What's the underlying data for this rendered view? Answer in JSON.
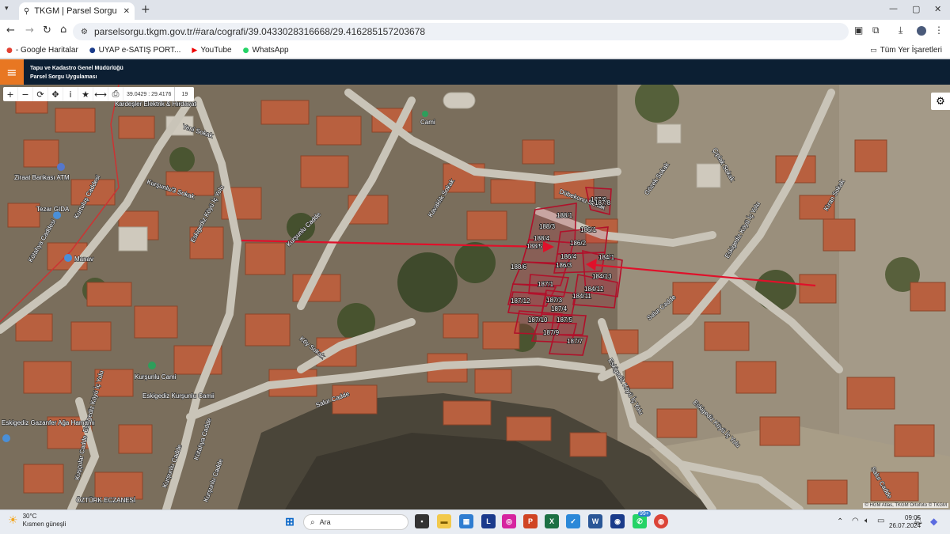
{
  "browser": {
    "tab_title": "TKGM | Parsel Sorgu Uygulamas",
    "url": "parselsorgu.tkgm.gov.tr/#ara/cografi/39.0433028316668/29.416285157203678",
    "bookmarks": [
      "- Google Haritalar",
      "UYAP e-SATIŞ PORT...",
      "YouTube",
      "WhatsApp"
    ],
    "all_bookmarks": "Tüm Yer İşaretleri"
  },
  "app": {
    "org_line1": "Tapu ve Kadastro Genel Müdürlüğü",
    "org_line2": "Parsel Sorgu Uygulaması",
    "coord_box": "39.0429 : 29.4176",
    "zoom": "19"
  },
  "map": {
    "streets": [
      "Yeni Sokak",
      "Kurşunlu/3 Sokak",
      "Kurtuluş Caddesi",
      "Eskigediz Köyü İç Yolu",
      "Kurşunlu Cadde",
      "Kavaklık Sokak",
      "Dübekonu Sokak",
      "Çıplak Sokak",
      "Gözek Sokak",
      "Eskigediz Köyü İç Yolu",
      "Kıran Sokak",
      "Salur Cadde",
      "Köy Sokak",
      "Salur Cadde",
      "Eskigediz Köyü İç Yolu",
      "Eskigediz Köyü İç Yolu",
      "Kurşunlu Cadde",
      "Kütahya Cadde",
      "Kurşunlu Cadde",
      "Eskigediz Köyü İç Yolu",
      "Kuşçular Cadde",
      "Salur Cadde",
      "Kütahya Caddesi"
    ],
    "pois": [
      "Kardeşler Elektrik & Hırdavat",
      "Ziraat Bankası ATM",
      "Tezar GIDA",
      "Manav",
      "Kurşunlu Cami",
      "Eskigediz Kurşunlu Camii",
      "Eskigediz Gazanfer Ağa Hamamı",
      "ÖZTÜRK ECZANESİ",
      "Cami"
    ],
    "parcels": [
      "187/6",
      "188/1",
      "188/3",
      "188/4",
      "188/5",
      "186/2",
      "186/1",
      "186/4",
      "186/3",
      "188/6",
      "184/1",
      "184/13",
      "184/12",
      "184/11",
      "187/1",
      "187/12",
      "187/3",
      "187/4",
      "187/10",
      "187/5",
      "187/9",
      "187/7",
      "187/8"
    ],
    "attribution": "© HGM Atlas, TKGM Ortofoto © TKGM"
  },
  "taskbar": {
    "temp": "30°C",
    "weather": "Kısmen güneşli",
    "search_placeholder": "Ara",
    "badge": "99+",
    "time": "09:05",
    "date": "26.07.2024"
  }
}
